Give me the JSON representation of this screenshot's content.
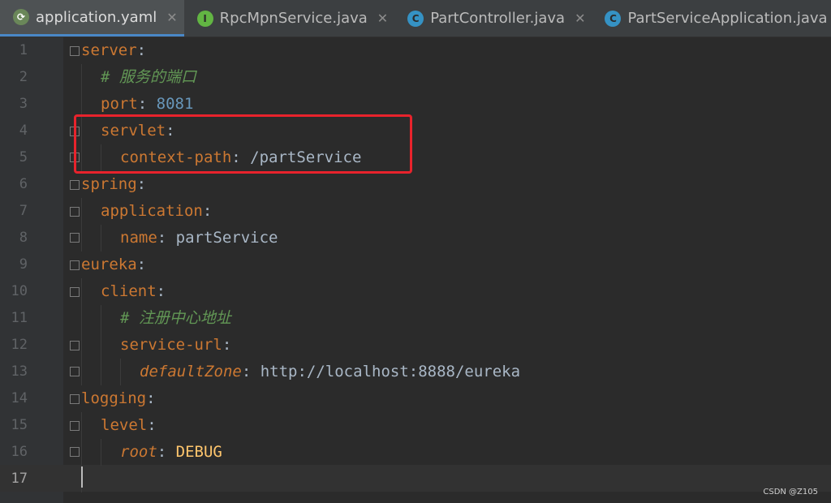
{
  "tabs": [
    {
      "label": "application.yaml",
      "icon": "spring-icon",
      "active": true
    },
    {
      "label": "RpcMpnService.java",
      "icon": "interface-icon",
      "active": false
    },
    {
      "label": "PartController.java",
      "icon": "class-icon",
      "active": false
    },
    {
      "label": "PartServiceApplication.java",
      "icon": "spring-boot-class-icon",
      "active": false
    }
  ],
  "colors": {
    "background": "#2b2b2b",
    "key": "#cc7832",
    "number": "#6897bb",
    "comment": "#629755",
    "highlight_box": "#e8232c"
  },
  "editor": {
    "lines": [
      {
        "num": "1",
        "key": "server",
        "colon": ":"
      },
      {
        "num": "2",
        "comment": "# 服务的端口"
      },
      {
        "num": "3",
        "key": "port",
        "colon": ": ",
        "num_value": "8081"
      },
      {
        "num": "4",
        "key": "servlet",
        "colon": ":"
      },
      {
        "num": "5",
        "key": "context-path",
        "colon": ": ",
        "value": "/partService"
      },
      {
        "num": "6",
        "key": "spring",
        "colon": ":"
      },
      {
        "num": "7",
        "key": "application",
        "colon": ":"
      },
      {
        "num": "8",
        "key": "name",
        "colon": ": ",
        "value": "partService"
      },
      {
        "num": "9",
        "key": "eureka",
        "colon": ":"
      },
      {
        "num": "10",
        "key": "client",
        "colon": ":"
      },
      {
        "num": "11",
        "comment": "# 注册中心地址"
      },
      {
        "num": "12",
        "key": "service-url",
        "colon": ":"
      },
      {
        "num": "13",
        "key": "defaultZone",
        "colon": ": ",
        "value": "http://localhost:8888/eureka"
      },
      {
        "num": "14",
        "key": "logging",
        "colon": ":"
      },
      {
        "num": "15",
        "key": "level",
        "colon": ":"
      },
      {
        "num": "16",
        "key": "root",
        "colon": ": ",
        "value": "DEBUG"
      },
      {
        "num": "17"
      }
    ]
  },
  "watermark": "CSDN @Z105"
}
